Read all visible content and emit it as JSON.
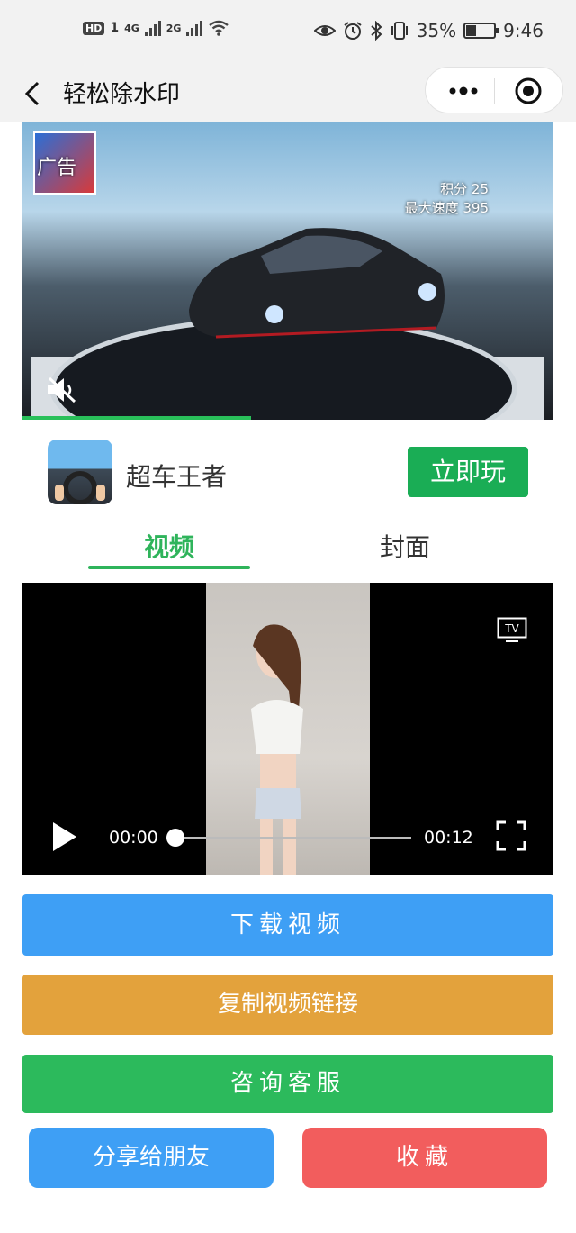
{
  "status_bar": {
    "hd": "HD",
    "sim": "1",
    "net1": "4G",
    "net2": "2G",
    "battery_percent": "35%",
    "battery_level": 0.35,
    "time": "9:46"
  },
  "nav": {
    "title": "轻松除水印"
  },
  "ad": {
    "label": "广告",
    "score_line": "积分 25",
    "speed_line": "最大速度 395",
    "progress": 0.43
  },
  "app": {
    "name": "超车王者",
    "play_label": "立即玩"
  },
  "tabs": [
    {
      "label": "视频",
      "active": true
    },
    {
      "label": "封面",
      "active": false
    }
  ],
  "player": {
    "tv_label": "TV",
    "current_time": "00:00",
    "total_time": "00:12",
    "progress": 0
  },
  "buttons": {
    "download": "下载视频",
    "copy_link": "复制视频链接",
    "service": "咨询客服",
    "share": "分享给朋友",
    "favorite": "收藏"
  },
  "colors": {
    "accent_green": "#2fb45b",
    "download_blue": "#3e9ff5",
    "copy_orange": "#e3a23c",
    "service_green": "#2cba5c",
    "favorite_red": "#f25d5d"
  }
}
